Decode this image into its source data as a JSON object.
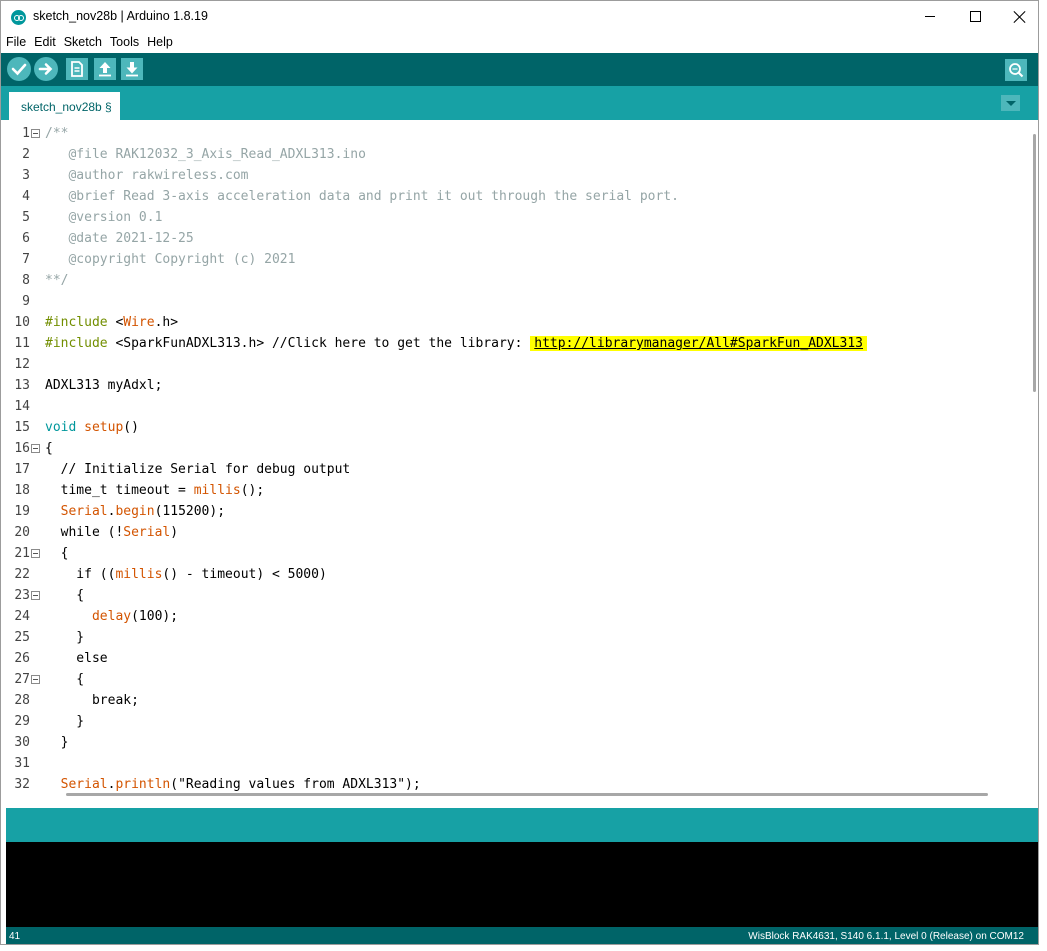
{
  "window": {
    "title": "sketch_nov28b | Arduino 1.8.19"
  },
  "menu": [
    "File",
    "Edit",
    "Sketch",
    "Tools",
    "Help"
  ],
  "toolbar": {
    "buttons": [
      "verify-icon",
      "upload-icon",
      "new-icon",
      "open-icon",
      "save-icon"
    ],
    "serial_monitor": "serial-monitor-icon"
  },
  "tab": {
    "label": "sketch_nov28b §"
  },
  "editor": {
    "lines": [
      {
        "n": "1",
        "fold": true,
        "parts": [
          {
            "t": "/**",
            "c": "comment"
          }
        ]
      },
      {
        "n": "2",
        "parts": [
          {
            "t": "   @file RAK12032_3_Axis_Read_ADXL313.ino",
            "c": "comment"
          }
        ]
      },
      {
        "n": "3",
        "parts": [
          {
            "t": "   @author rakwireless.com",
            "c": "comment"
          }
        ]
      },
      {
        "n": "4",
        "parts": [
          {
            "t": "   @brief Read 3-axis acceleration data and print it out through the serial port.",
            "c": "comment"
          }
        ]
      },
      {
        "n": "5",
        "parts": [
          {
            "t": "   @version 0.1",
            "c": "comment"
          }
        ]
      },
      {
        "n": "6",
        "parts": [
          {
            "t": "   @date 2021-12-25",
            "c": "comment"
          }
        ]
      },
      {
        "n": "7",
        "parts": [
          {
            "t": "   @copyright Copyright (c) 2021",
            "c": "comment"
          }
        ]
      },
      {
        "n": "8",
        "parts": [
          {
            "t": "**/",
            "c": "comment"
          }
        ]
      },
      {
        "n": "9",
        "parts": []
      },
      {
        "n": "10",
        "parts": [
          {
            "t": "#include",
            "c": "kw"
          },
          {
            "t": " <"
          },
          {
            "t": "Wire",
            "c": "fn"
          },
          {
            "t": ".h>"
          }
        ]
      },
      {
        "n": "11",
        "parts": [
          {
            "t": "#include",
            "c": "kw"
          },
          {
            "t": " <SparkFunADXL313.h> //Click here to get the library: "
          },
          {
            "t": "http://librarymanager/All#SparkFun_ADXL313",
            "c": "link"
          }
        ]
      },
      {
        "n": "12",
        "parts": []
      },
      {
        "n": "13",
        "parts": [
          {
            "t": "ADXL313 myAdxl;"
          }
        ]
      },
      {
        "n": "14",
        "parts": []
      },
      {
        "n": "15",
        "parts": [
          {
            "t": "void",
            "c": "type"
          },
          {
            "t": " "
          },
          {
            "t": "setup",
            "c": "fn"
          },
          {
            "t": "()"
          }
        ]
      },
      {
        "n": "16",
        "fold": true,
        "parts": [
          {
            "t": "{"
          }
        ]
      },
      {
        "n": "17",
        "parts": [
          {
            "t": "  // Initialize Serial for debug output"
          }
        ]
      },
      {
        "n": "18",
        "parts": [
          {
            "t": "  time_t timeout = "
          },
          {
            "t": "millis",
            "c": "fn"
          },
          {
            "t": "();"
          }
        ]
      },
      {
        "n": "19",
        "parts": [
          {
            "t": "  "
          },
          {
            "t": "Serial",
            "c": "fn"
          },
          {
            "t": "."
          },
          {
            "t": "begin",
            "c": "fn"
          },
          {
            "t": "(115200);"
          }
        ]
      },
      {
        "n": "20",
        "parts": [
          {
            "t": "  while (!"
          },
          {
            "t": "Serial",
            "c": "fn"
          },
          {
            "t": ")"
          }
        ]
      },
      {
        "n": "21",
        "fold": true,
        "parts": [
          {
            "t": "  {"
          }
        ]
      },
      {
        "n": "22",
        "parts": [
          {
            "t": "    if (("
          },
          {
            "t": "millis",
            "c": "fn"
          },
          {
            "t": "() - timeout) < 5000)"
          }
        ]
      },
      {
        "n": "23",
        "fold": true,
        "parts": [
          {
            "t": "    {"
          }
        ]
      },
      {
        "n": "24",
        "parts": [
          {
            "t": "      "
          },
          {
            "t": "delay",
            "c": "fn"
          },
          {
            "t": "(100);"
          }
        ]
      },
      {
        "n": "25",
        "parts": [
          {
            "t": "    }"
          }
        ]
      },
      {
        "n": "26",
        "parts": [
          {
            "t": "    else"
          }
        ]
      },
      {
        "n": "27",
        "fold": true,
        "parts": [
          {
            "t": "    {"
          }
        ]
      },
      {
        "n": "28",
        "parts": [
          {
            "t": "      break;"
          }
        ]
      },
      {
        "n": "29",
        "parts": [
          {
            "t": "    }"
          }
        ]
      },
      {
        "n": "30",
        "parts": [
          {
            "t": "  }"
          }
        ]
      },
      {
        "n": "31",
        "parts": []
      },
      {
        "n": "32",
        "parts": [
          {
            "t": "  "
          },
          {
            "t": "Serial",
            "c": "fn"
          },
          {
            "t": "."
          },
          {
            "t": "println",
            "c": "fn"
          },
          {
            "t": "(\"Reading values from ADXL313\");"
          }
        ]
      }
    ]
  },
  "status": {
    "line": "41",
    "board": "WisBlock RAK4631, S140  6.1.1, Level 0 (Release) on COM12"
  },
  "colors": {
    "toolbar": "#006468",
    "tabbar": "#17a1a5",
    "comment": "#95a5a6",
    "keyword": "#728e00",
    "function": "#d35400",
    "link_highlight": "#ffff00"
  }
}
